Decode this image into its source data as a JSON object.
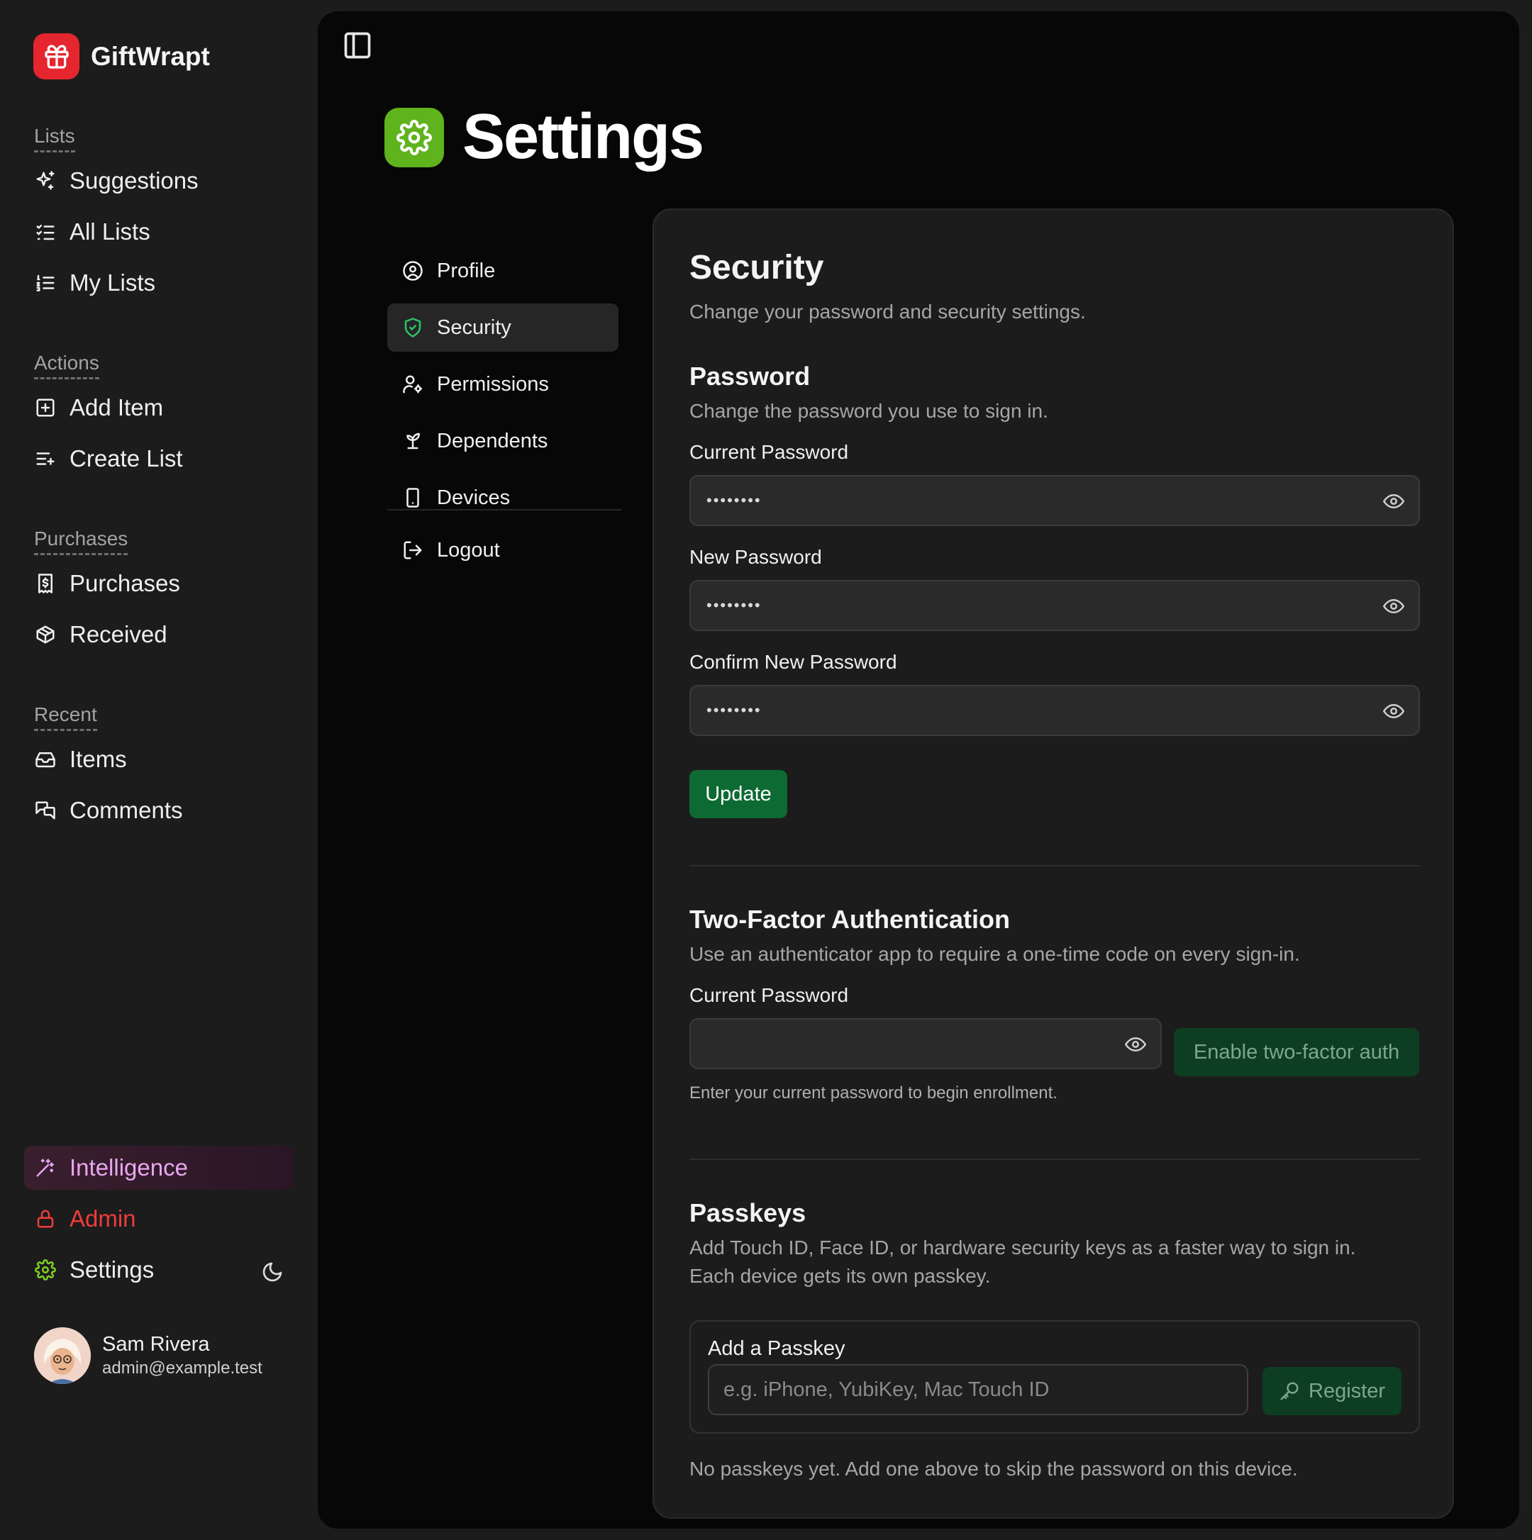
{
  "app": {
    "name": "GiftWrapt"
  },
  "sidebar": {
    "sections": [
      {
        "label": "Lists",
        "items": [
          {
            "label": "Suggestions",
            "icon": "sparkles-icon"
          },
          {
            "label": "All Lists",
            "icon": "list-checks-icon"
          },
          {
            "label": "My Lists",
            "icon": "list-ordered-icon"
          }
        ]
      },
      {
        "label": "Actions",
        "items": [
          {
            "label": "Add Item",
            "icon": "square-plus-icon"
          },
          {
            "label": "Create List",
            "icon": "list-plus-icon"
          }
        ]
      },
      {
        "label": "Purchases",
        "items": [
          {
            "label": "Purchases",
            "icon": "receipt-icon"
          },
          {
            "label": "Received",
            "icon": "package-icon"
          }
        ]
      },
      {
        "label": "Recent",
        "items": [
          {
            "label": "Items",
            "icon": "inbox-icon"
          },
          {
            "label": "Comments",
            "icon": "messages-icon"
          }
        ]
      }
    ],
    "bottom": {
      "intelligence": "Intelligence",
      "admin": "Admin",
      "settings": "Settings"
    },
    "user": {
      "name": "Sam Rivera",
      "email": "admin@example.test"
    },
    "colors": {
      "intelligence": "#e9a6f0",
      "admin": "#ef3b3b",
      "settings_icon": "#7ed321",
      "brand": "#e5262e"
    }
  },
  "page": {
    "title": "Settings",
    "icon": "gear-icon",
    "icon_color": "#5fb31c"
  },
  "settings_nav": {
    "items": [
      {
        "label": "Profile",
        "icon": "user-circle-icon"
      },
      {
        "label": "Security",
        "icon": "shield-check-icon",
        "active": true
      },
      {
        "label": "Permissions",
        "icon": "user-cog-icon"
      },
      {
        "label": "Dependents",
        "icon": "sprout-icon"
      },
      {
        "label": "Devices",
        "icon": "smartphone-icon"
      }
    ],
    "logout": "Logout"
  },
  "security": {
    "title": "Security",
    "subtitle": "Change your password and security settings.",
    "password": {
      "title": "Password",
      "description": "Change the password you use to sign in.",
      "current_label": "Current Password",
      "current_value": "••••••••",
      "new_label": "New Password",
      "new_value": "••••••••",
      "confirm_label": "Confirm New Password",
      "confirm_value": "••••••••",
      "update_button": "Update"
    },
    "two_factor": {
      "title": "Two-Factor Authentication",
      "description": "Use an authenticator app to require a one-time code on every sign-in.",
      "current_label": "Current Password",
      "current_value": "",
      "enable_button": "Enable two-factor auth",
      "hint": "Enter your current password to begin enrollment."
    },
    "passkeys": {
      "title": "Passkeys",
      "description_line1": "Add Touch ID, Face ID, or hardware security keys as a faster way to sign in.",
      "description_line2": "Each device gets its own passkey.",
      "add_label": "Add a Passkey",
      "input_placeholder": "e.g. iPhone, YubiKey, Mac Touch ID",
      "register_button": "Register",
      "empty_text": "No passkeys yet. Add one above to skip the password on this device."
    },
    "colors": {
      "primary_button": "#0d6a32",
      "disabled_button": "#0d3e22",
      "active_icon": "#2bc46a"
    }
  }
}
